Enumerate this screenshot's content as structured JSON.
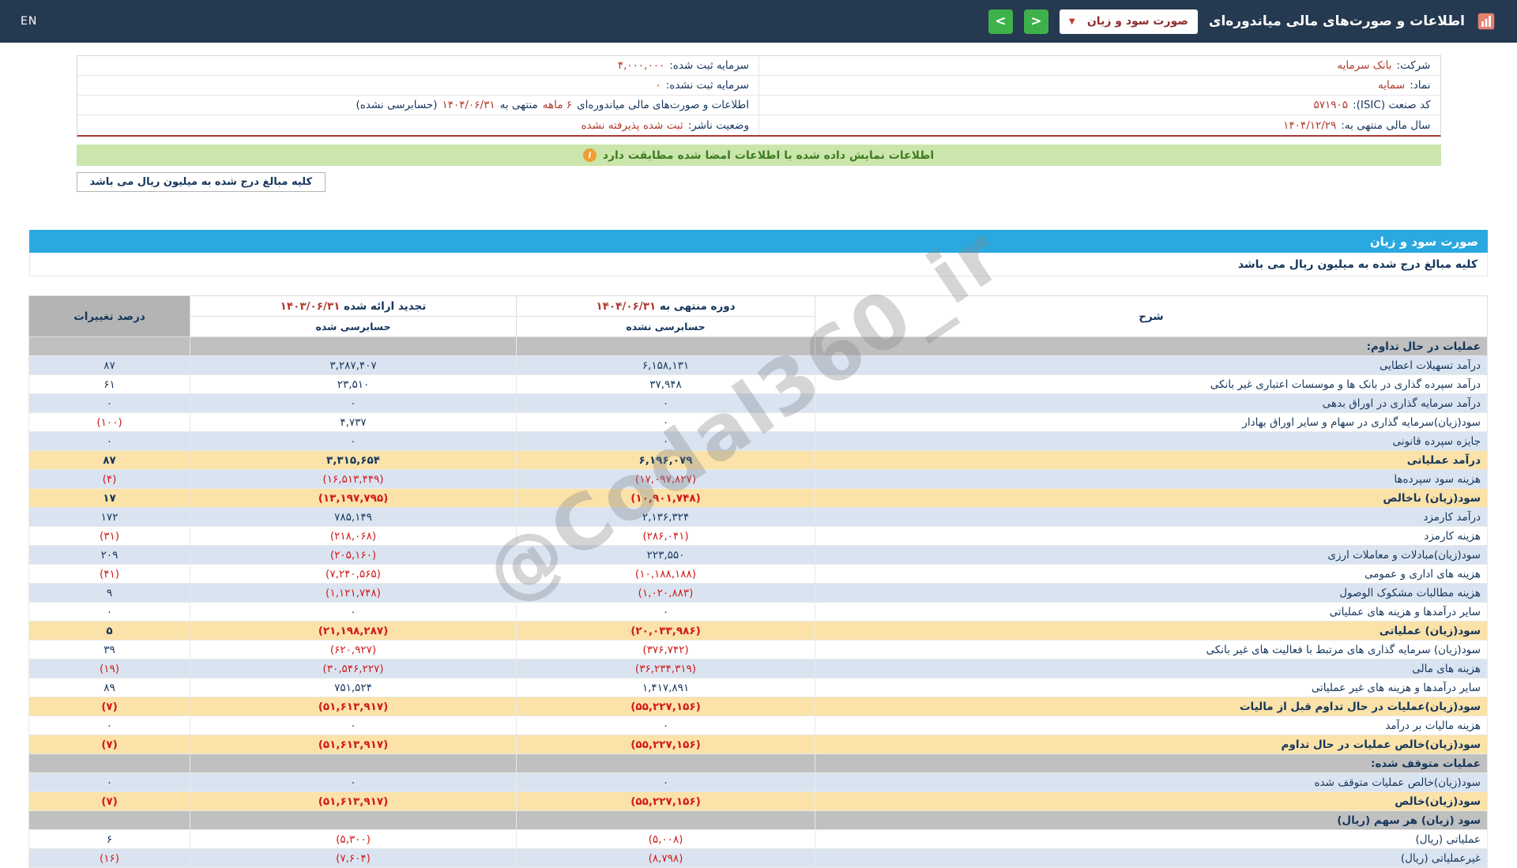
{
  "topbar": {
    "title": "اطلاعات و صورت‌های مالی میاندوره‌ای",
    "report_select": "صورت سود و زیان",
    "caret": "▼",
    "nav_right": "<",
    "nav_left": ">",
    "lang": "EN"
  },
  "info": {
    "rows": [
      {
        "right": [
          {
            "t": "شرکت:",
            "red": false
          },
          {
            "t": "بانک سرمایه",
            "red": true
          }
        ],
        "left": [
          {
            "t": "سرمایه ثبت شده:",
            "red": false
          },
          {
            "t": "۴,۰۰۰,۰۰۰",
            "red": true
          }
        ]
      },
      {
        "right": [
          {
            "t": "نماد:",
            "red": false
          },
          {
            "t": "سمایه",
            "red": true
          }
        ],
        "left": [
          {
            "t": "سرمایه ثبت نشده:",
            "red": false
          },
          {
            "t": "۰",
            "red": true
          }
        ]
      },
      {
        "right": [
          {
            "t": "کد صنعت (ISIC):",
            "red": false
          },
          {
            "t": "۵۷۱۹۰۵",
            "red": true
          }
        ],
        "left": [
          {
            "t": "اطلاعات و صورت‌های مالی میاندوره‌ای",
            "red": false
          },
          {
            "t": "۶ ماهه",
            "red": true
          },
          {
            "t": "منتهی به",
            "red": false
          },
          {
            "t": "۱۴۰۴/۰۶/۳۱",
            "red": true
          },
          {
            "t": "(حسابرسی نشده)",
            "red": false
          }
        ]
      },
      {
        "right": [
          {
            "t": "سال مالی منتهی به:",
            "red": false
          },
          {
            "t": "۱۴۰۴/۱۲/۲۹",
            "red": true
          }
        ],
        "left": [
          {
            "t": "وضعیت ناشر:",
            "red": false
          },
          {
            "t": "ثبت شده پذیرفته نشده",
            "red": true
          }
        ]
      }
    ]
  },
  "banner": {
    "text": "اطلاعات نمایش داده شده با اطلاعات امضا شده مطابقت دارد",
    "icon": "i"
  },
  "unit_note": "کلیه مبالغ درج شده به میلیون ریال می باشد",
  "statement": {
    "title": "صورت سود و زیان",
    "unit_note": "کلیه مبالغ درج شده به میلیون ریال می باشد"
  },
  "table": {
    "headers": {
      "desc": "شرح",
      "col1_title": "دوره منتهی به",
      "col1_date": "۱۴۰۴/۰۶/۳۱",
      "col1_sub": "حسابرسی نشده",
      "col2_title": "تجدید ارائه شده",
      "col2_date": "۱۴۰۳/۰۶/۳۱",
      "col2_sub": "حسابرسی شده",
      "pct": "درصد تغییرات"
    },
    "rows": [
      {
        "type": "section",
        "desc": "عملیات در حال تداوم:",
        "v1": "",
        "v2": "",
        "pct": ""
      },
      {
        "type": "data",
        "desc": "درآمد تسهیلات اعطایی",
        "v1": "۶,۱۵۸,۱۳۱",
        "v2": "۳,۲۸۷,۴۰۷",
        "pct": "۸۷"
      },
      {
        "type": "data",
        "desc": "درآمد سپرده گذاری در بانک ها و موسسات اعتباری غیر بانکی",
        "v1": "۳۷,۹۴۸",
        "v2": "۲۳,۵۱۰",
        "pct": "۶۱"
      },
      {
        "type": "data",
        "desc": "درآمد سرمایه گذاری در اوراق بدهی",
        "v1": "۰",
        "v2": "۰",
        "pct": "۰"
      },
      {
        "type": "data",
        "desc": "سود(زیان)سرمایه گذاری در سهام و سایر اوراق بهادار",
        "v1": "۰",
        "v2": "۴,۷۳۷",
        "pct": "(۱۰۰)"
      },
      {
        "type": "data",
        "desc": "جایزه سپرده قانونی",
        "v1": "۰",
        "v2": "۰",
        "pct": "۰"
      },
      {
        "type": "highlight",
        "desc": "درآمد عملیاتی",
        "v1": "۶,۱۹۶,۰۷۹",
        "v2": "۳,۳۱۵,۶۵۴",
        "pct": "۸۷"
      },
      {
        "type": "data",
        "desc": "هزینه سود سپرده‌ها",
        "v1": "(۱۷,۰۹۷,۸۲۷)",
        "v2": "(۱۶,۵۱۳,۴۴۹)",
        "pct": "(۴)"
      },
      {
        "type": "highlight",
        "desc": "سود(زیان) ناخالص",
        "v1": "(۱۰,۹۰۱,۷۴۸)",
        "v2": "(۱۳,۱۹۷,۷۹۵)",
        "pct": "۱۷"
      },
      {
        "type": "data",
        "desc": "درآمد کارمزد",
        "v1": "۲,۱۳۶,۳۲۴",
        "v2": "۷۸۵,۱۴۹",
        "pct": "۱۷۲"
      },
      {
        "type": "data",
        "desc": "هزینه کارمزد",
        "v1": "(۲۸۶,۰۴۱)",
        "v2": "(۲۱۸,۰۶۸)",
        "pct": "(۳۱)"
      },
      {
        "type": "data",
        "desc": "سود(زیان)مبادلات و معاملات ارزی",
        "v1": "۲۲۳,۵۵۰",
        "v2": "(۲۰۵,۱۶۰)",
        "pct": "۲۰۹"
      },
      {
        "type": "data",
        "desc": "هزینه های اداری و عمومی",
        "v1": "(۱۰,۱۸۸,۱۸۸)",
        "v2": "(۷,۲۴۰,۵۶۵)",
        "pct": "(۴۱)"
      },
      {
        "type": "data",
        "desc": "هزینه مطالبات مشکوک الوصول",
        "v1": "(۱,۰۲۰,۸۸۳)",
        "v2": "(۱,۱۲۱,۷۴۸)",
        "pct": "۹"
      },
      {
        "type": "data",
        "desc": "سایر درآمدها و هزینه های عملیاتی",
        "v1": "۰",
        "v2": "۰",
        "pct": "۰"
      },
      {
        "type": "highlight",
        "desc": "سود(زیان) عملیاتی",
        "v1": "(۲۰,۰۳۳,۹۸۶)",
        "v2": "(۲۱,۱۹۸,۲۸۷)",
        "pct": "۵"
      },
      {
        "type": "data",
        "desc": "سود(زیان) سرمایه گذاری های مرتبط با فعالیت های غیر بانکی",
        "v1": "(۳۷۶,۷۴۲)",
        "v2": "(۶۲۰,۹۲۷)",
        "pct": "۳۹"
      },
      {
        "type": "data",
        "desc": "هزینه های مالی",
        "v1": "(۳۶,۲۳۴,۳۱۹)",
        "v2": "(۳۰,۵۴۶,۲۲۷)",
        "pct": "(۱۹)"
      },
      {
        "type": "data",
        "desc": "سایر درآمدها و هزینه های غیر عملیاتی",
        "v1": "۱,۴۱۷,۸۹۱",
        "v2": "۷۵۱,۵۲۴",
        "pct": "۸۹"
      },
      {
        "type": "highlight",
        "desc": "سود(زیان)عملیات در حال تداوم قبل از مالیات",
        "v1": "(۵۵,۲۲۷,۱۵۶)",
        "v2": "(۵۱,۶۱۳,۹۱۷)",
        "pct": "(۷)"
      },
      {
        "type": "data",
        "desc": "هزینه مالیات بر درآمد",
        "v1": "۰",
        "v2": "۰",
        "pct": "۰"
      },
      {
        "type": "highlight",
        "desc": "سود(زیان)خالص عملیات در حال تداوم",
        "v1": "(۵۵,۲۲۷,۱۵۶)",
        "v2": "(۵۱,۶۱۳,۹۱۷)",
        "pct": "(۷)"
      },
      {
        "type": "section",
        "desc": "عملیات متوقف شده:",
        "v1": "",
        "v2": "",
        "pct": ""
      },
      {
        "type": "data",
        "desc": "سود(زیان)خالص عملیات متوقف شده",
        "v1": "۰",
        "v2": "۰",
        "pct": "۰"
      },
      {
        "type": "highlight",
        "desc": "سود(زیان)خالص",
        "v1": "(۵۵,۲۲۷,۱۵۶)",
        "v2": "(۵۱,۶۱۳,۹۱۷)",
        "pct": "(۷)"
      },
      {
        "type": "section",
        "desc": "سود (زیان) هر سهم (ریال)",
        "v1": "",
        "v2": "",
        "pct": ""
      },
      {
        "type": "data",
        "desc": "عملیاتی (ریال)",
        "v1": "(۵,۰۰۸)",
        "v2": "(۵,۳۰۰)",
        "pct": "۶"
      },
      {
        "type": "data",
        "desc": "غیرعملیاتی (ریال)",
        "v1": "(۸,۷۹۸)",
        "v2": "(۷,۶۰۴)",
        "pct": "(۱۶)"
      }
    ]
  },
  "watermark": "@Codal360_ir"
}
